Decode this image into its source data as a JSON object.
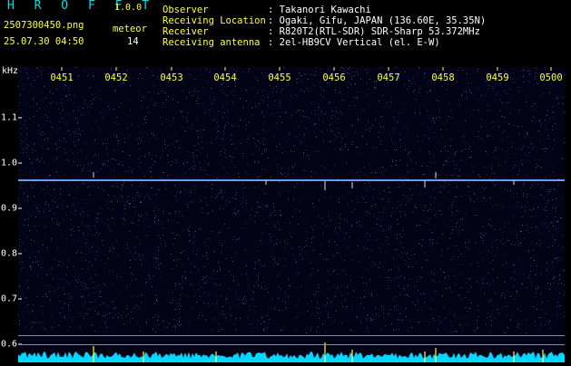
{
  "header": {
    "app_title": "H R O F F T",
    "version": "1.0.0",
    "filename": "2507300450.png",
    "datetime": "25.07.30 04:50",
    "meteor_label": "meteor",
    "meteor_count": "14",
    "observer_label": "Observer",
    "observer_value": ": Takanori Kawachi",
    "location_label": "Receiving Location",
    "location_value": ": Ogaki, Gifu, JAPAN (136.60E, 35.35N)",
    "receiver_label": "Receiver",
    "receiver_value": ": R820T2(RTL-SDR) SDR-Sharp 53.372MHz",
    "antenna_label": "Receiving antenna",
    "antenna_value": ": 2el-HB9CV Vertical (el. E-W)"
  },
  "axis": {
    "unit": "kHz",
    "x_ticks": [
      "0451",
      "0452",
      "0453",
      "0454",
      "0455",
      "0456",
      "0457",
      "0458",
      "0459",
      "0500"
    ],
    "y_ticks": [
      "1.1",
      "1.0",
      "0.9",
      "0.8",
      "0.7",
      "0.6"
    ]
  },
  "colors": {
    "background": "#000000",
    "title": "#00e0e0",
    "header_text": "#ffff40",
    "spectrogram_bg": "#030316",
    "carrier": "#5aa0ff",
    "noise_floor": "#00d8ff",
    "marker": "#ffff40"
  }
}
